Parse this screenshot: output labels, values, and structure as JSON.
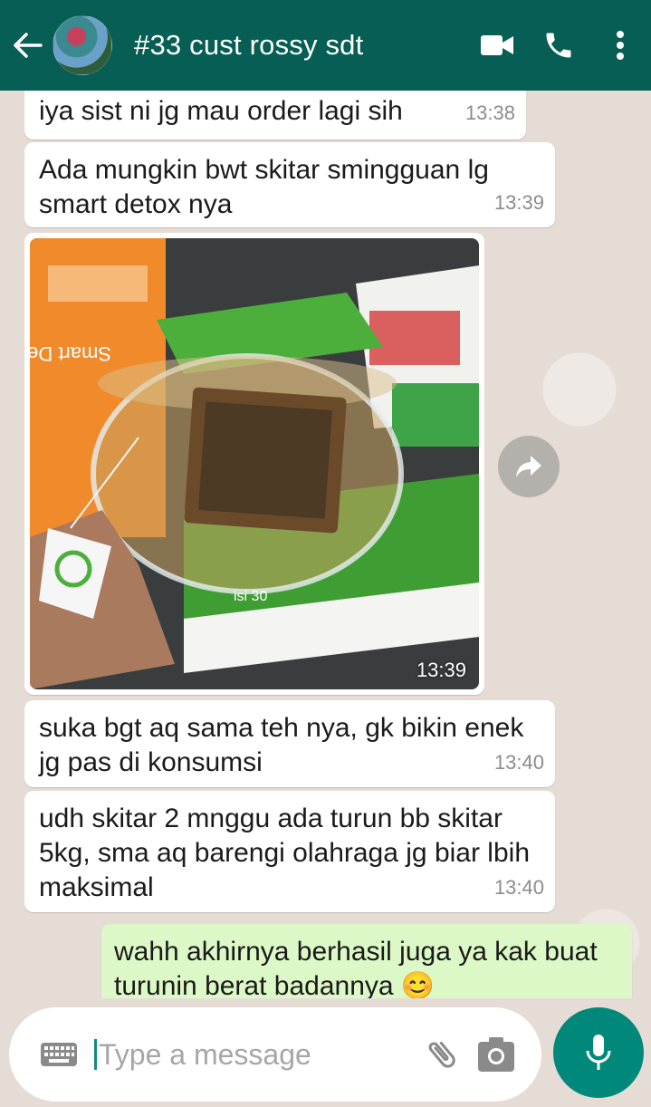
{
  "header": {
    "title": "#33 cust rossy sdt",
    "back_icon": "arrow-left-icon",
    "video_icon": "video-call-icon",
    "call_icon": "phone-icon",
    "menu_icon": "more-vert-icon"
  },
  "messages": [
    {
      "direction": "in",
      "text": "iya sist ni jg mau order lagi sih",
      "time": "13:38"
    },
    {
      "direction": "in",
      "text": "Ada mungkin bwt skitar smingguan lg smart detox nya",
      "time": "13:39"
    },
    {
      "direction": "in",
      "type": "image",
      "time": "13:39"
    },
    {
      "direction": "in",
      "text": "suka bgt aq sama teh nya, gk bikin enek jg pas di konsumsi",
      "time": "13:40"
    },
    {
      "direction": "in",
      "text": "udh skitar 2 mnggu ada turun bb skitar 5kg, sma aq barengi olahraga jg biar lbih maksimal",
      "time": "13:40"
    },
    {
      "direction": "out",
      "text": "wahh akhirnya berhasil juga ya kak buat turunin berat badannya 😊"
    }
  ],
  "photo_labels": {
    "box_side": "Smart Detox Tea",
    "box_count": "isi 30"
  },
  "composer": {
    "placeholder": "Type a message",
    "keyboard_icon": "keyboard-icon",
    "attach_icon": "paperclip-icon",
    "camera_icon": "camera-icon",
    "mic_icon": "microphone-icon"
  },
  "colors": {
    "header": "#075e54",
    "outgoing_bubble": "#dcf8c6",
    "incoming_bubble": "#ffffff",
    "mic_button": "#00897b",
    "chat_background": "#e5ddd5"
  }
}
